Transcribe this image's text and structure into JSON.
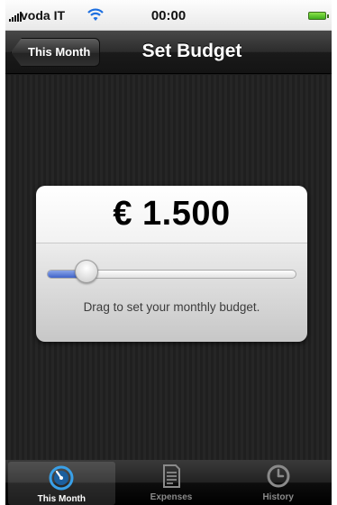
{
  "status_bar": {
    "carrier": "voda IT",
    "time": "00:00"
  },
  "nav_bar": {
    "back_label": "This Month",
    "title": "Set Budget"
  },
  "budget_card": {
    "amount": "€ 1.500",
    "slider_value_fraction": 0.16,
    "hint": "Drag to set your monthly budget."
  },
  "tab_bar": {
    "tabs": [
      {
        "label": "This Month",
        "icon": "speedometer-icon",
        "active": true
      },
      {
        "label": "Expenses",
        "icon": "document-icon",
        "active": false
      },
      {
        "label": "History",
        "icon": "clock-icon",
        "active": false
      }
    ]
  },
  "colors": {
    "slider_fill": "#3f63c9",
    "battery": "#3fae1c",
    "active_tab_icon": "#39a0e8"
  }
}
